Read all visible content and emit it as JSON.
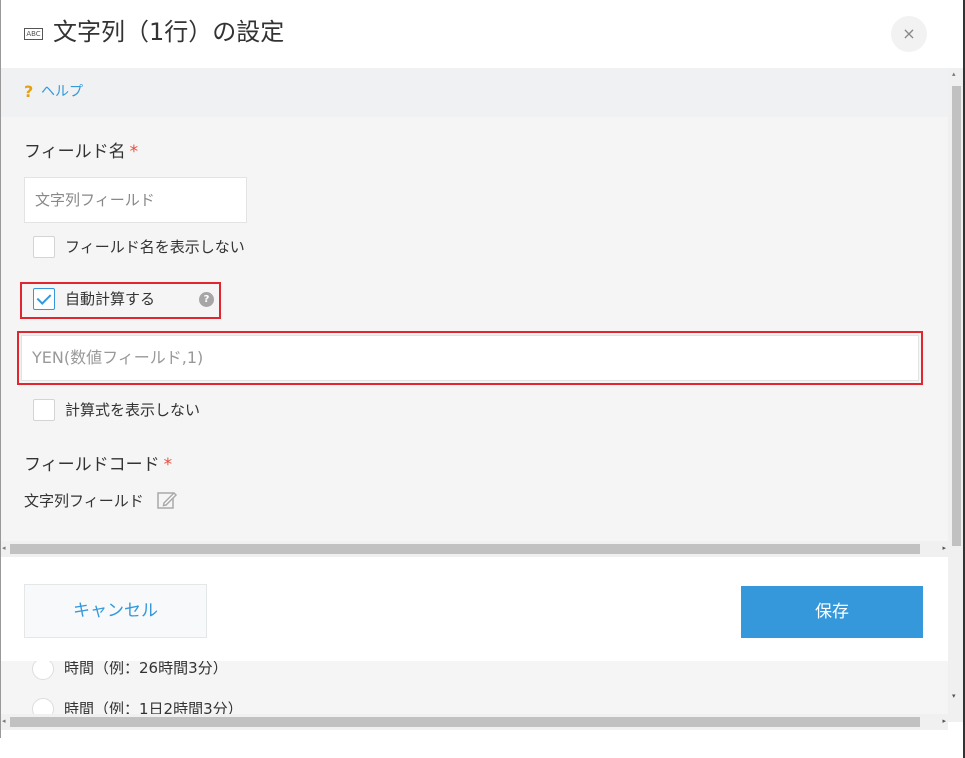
{
  "header": {
    "icon_text": "ABC",
    "title": "文字列（1行）の設定",
    "close_label": "×"
  },
  "help": {
    "icon": "?",
    "label": "ヘルプ"
  },
  "form": {
    "field_name_label": "フィールド名",
    "required_mark": "*",
    "field_name_value": "文字列フィールド",
    "hide_field_name_label": "フィールド名を表示しない",
    "hide_field_name_checked": false,
    "auto_calc_label": "自動計算する",
    "auto_calc_checked": true,
    "auto_calc_help_icon": "?",
    "formula_value": "YEN(数値フィールド,1)",
    "hide_formula_label": "計算式を表示しない",
    "hide_formula_checked": false,
    "field_code_label": "フィールドコード",
    "field_code_value": "文字列フィールド"
  },
  "footer": {
    "cancel_label": "キャンセル",
    "save_label": "保存"
  },
  "background": {
    "radio_1_label": "時間（例：26時間3分）",
    "radio_2_label": "時間（例：1日2時間3分）"
  },
  "colors": {
    "accent": "#3498db",
    "required": "#e74c3c",
    "highlight_box": "#e0262e",
    "help_icon": "#e4a115"
  }
}
